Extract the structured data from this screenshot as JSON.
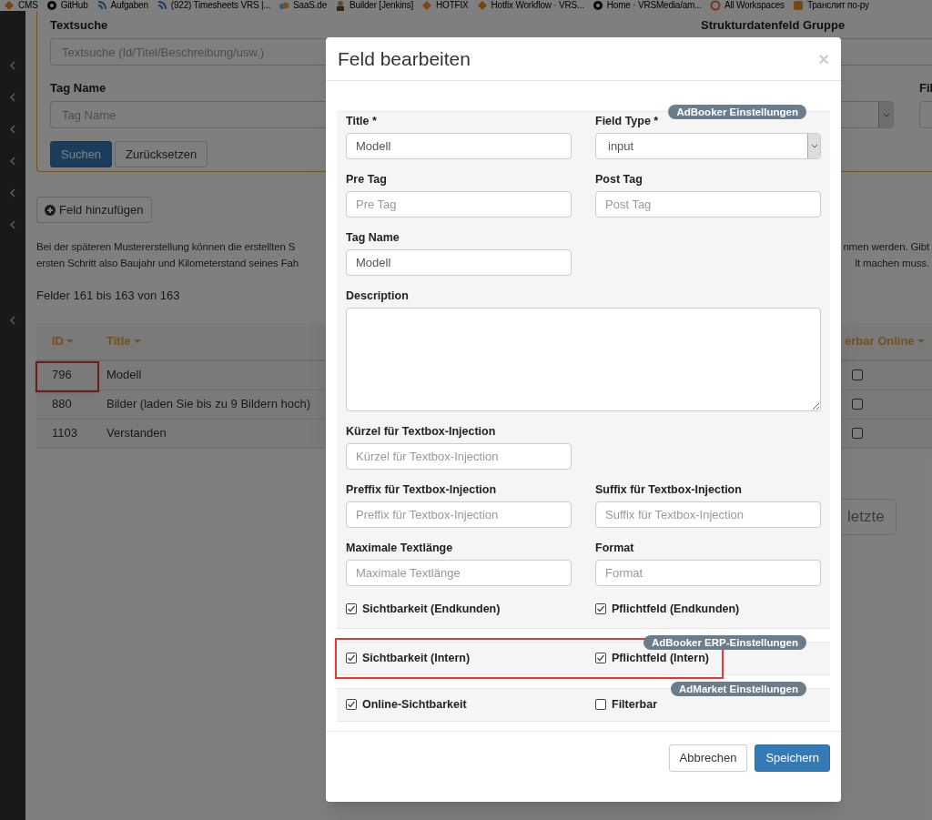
{
  "bookmarks": [
    {
      "label": "CMS",
      "kind": "orange"
    },
    {
      "label": "GitHub",
      "kind": "github"
    },
    {
      "label": "Aufgaben",
      "kind": "blue"
    },
    {
      "label": "(922) Timesheets VRS |...",
      "kind": "blue"
    },
    {
      "label": "SaaS.de",
      "kind": "cloud"
    },
    {
      "label": "Builder [Jenkins]",
      "kind": "user"
    },
    {
      "label": "HOTFIX",
      "kind": "orange"
    },
    {
      "label": "Hotfix Workflow · VRS...",
      "kind": "orange"
    },
    {
      "label": "Home · VRSMedia/am...",
      "kind": "github"
    },
    {
      "label": "All Workspaces",
      "kind": "ring"
    },
    {
      "label": "Транслит по-ру",
      "kind": "square"
    }
  ],
  "filter": {
    "search": {
      "label": "Textsuche",
      "placeholder": "Textsuche (Id/Titel/Beschreibung/usw.)"
    },
    "group_label": "Strukturdatenfeld Gruppe",
    "tag_name": {
      "label": "Tag Name",
      "placeholder": "Tag Name"
    },
    "cut_label": "Fil",
    "buttons": [
      {
        "label": "Suchen",
        "kind": "primary"
      },
      {
        "label": "Zurücksetzen",
        "kind": "default"
      }
    ]
  },
  "add_button": "Feld hinzufügen",
  "description_lines": [
    {
      "left": "Bei der späteren Mustererstellung können die erstellten S",
      "right": "nmen werden. Gibt"
    },
    {
      "left": "ersten Schritt also Baujahr und Kilometerstand seines Fah",
      "right": "lt machen muss."
    }
  ],
  "count_text": "Felder 161 bis 163 von 163",
  "table": {
    "columns": [
      "ID",
      "Title",
      "erbar Online"
    ],
    "rows": [
      {
        "id": "796",
        "title": "Modell",
        "checked": false,
        "annotated": true
      },
      {
        "id": "880",
        "title": "Bilder (laden Sie bis zu 9 Bildern hoch)",
        "checked": false,
        "annotated": false
      },
      {
        "id": "1103",
        "title": "Verstanden",
        "checked": false,
        "annotated": false
      }
    ]
  },
  "pagination": [
    "letzte"
  ],
  "dialog": {
    "title": "Feld bearbeiten",
    "close": "×",
    "sections": [
      {
        "badge": "AdBooker Einstellungen",
        "annotated": false,
        "rows": [
          [
            {
              "kind": "input",
              "label": "Title *",
              "value": "Modell"
            },
            {
              "kind": "select",
              "label": "Field Type *",
              "value": "input"
            }
          ],
          [
            {
              "kind": "input",
              "label": "Pre Tag",
              "placeholder": "Pre Tag"
            },
            {
              "kind": "input",
              "label": "Post Tag",
              "placeholder": "Post Tag"
            }
          ],
          [
            {
              "kind": "input",
              "label": "Tag Name",
              "value": "Modell"
            }
          ],
          [
            {
              "kind": "textarea",
              "label": "Description"
            }
          ],
          [
            {
              "kind": "input",
              "label": "Kürzel für Textbox-Injection",
              "placeholder": "Kürzel für Textbox-Injection"
            }
          ],
          [
            {
              "kind": "input",
              "label": "Preffix für Textbox-Injection",
              "placeholder": "Preffix für Textbox-Injection"
            },
            {
              "kind": "input",
              "label": "Suffix für Textbox-Injection",
              "placeholder": "Suffix für Textbox-Injection"
            }
          ],
          [
            {
              "kind": "input",
              "label": "Maximale Textlänge",
              "placeholder": "Maximale Textlänge"
            },
            {
              "kind": "input",
              "label": "Format",
              "placeholder": "Format"
            }
          ]
        ],
        "checks": [
          {
            "label": "Sichtbarkeit (Endkunden)",
            "checked": true
          },
          {
            "label": "Pflichtfeld (Endkunden)",
            "checked": true
          }
        ]
      },
      {
        "badge": "AdBooker ERP-Einstellungen",
        "annotated": true,
        "checks": [
          {
            "label": "Sichtbarkeit (Intern)",
            "checked": true
          },
          {
            "label": "Pflichtfeld (Intern)",
            "checked": true
          }
        ]
      },
      {
        "badge": "AdMarket Einstellungen",
        "annotated": false,
        "checks": [
          {
            "label": "Online-Sichtbarkeit",
            "checked": true
          },
          {
            "label": "Filterbar",
            "checked": false
          }
        ]
      }
    ],
    "buttons": [
      {
        "label": "Abbrechen",
        "kind": "default"
      },
      {
        "label": "Speichern",
        "kind": "primary"
      }
    ]
  }
}
